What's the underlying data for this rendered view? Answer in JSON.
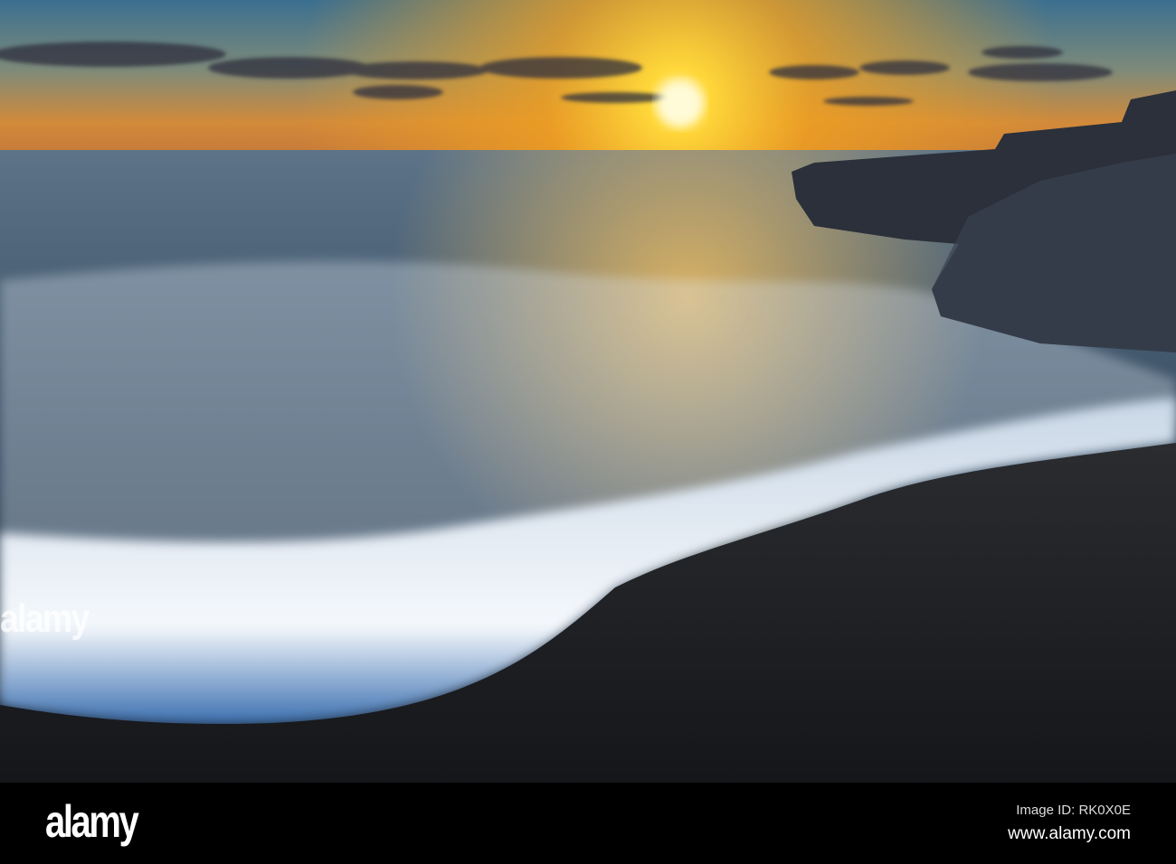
{
  "photo": {
    "subject": "sunset-beach-waves",
    "colors": {
      "sun": "#fff4a0",
      "sky_glow": "#f4a81c",
      "sky_top": "#3d6c8c",
      "sea": "#2f4a63",
      "foam": "#eef4fb",
      "sand": "#1c1e22",
      "rock": "#2a2e36"
    }
  },
  "watermark": {
    "text": "alamy"
  },
  "footer": {
    "logo": "alamy",
    "image_id": "Image ID: RK0X0E",
    "url": "www.alamy.com"
  }
}
